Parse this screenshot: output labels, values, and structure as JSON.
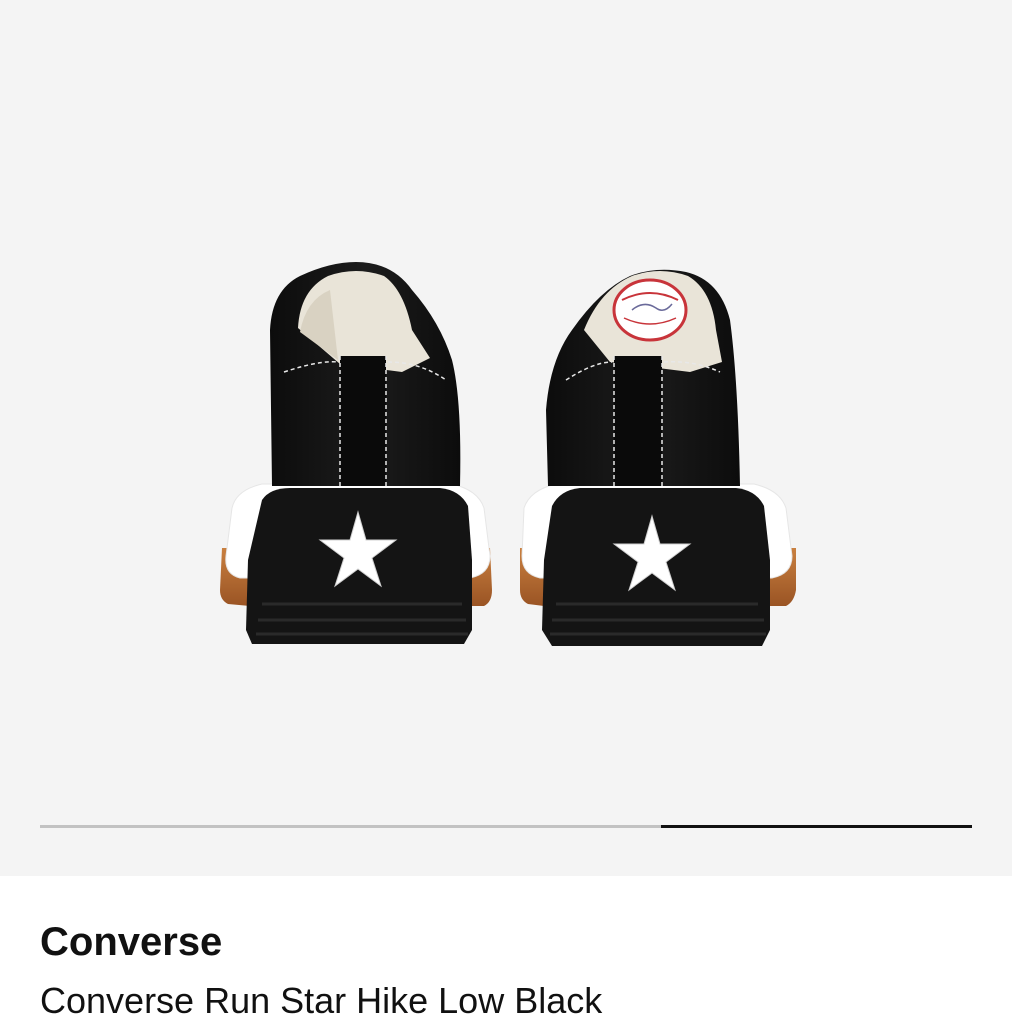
{
  "product": {
    "brand": "Converse",
    "name": "Converse Run Star Hike Low Black"
  },
  "gallery": {
    "image_description": "Black Converse Run Star Hike low sneakers, rear view",
    "background_color": "#f4f4f4",
    "indicator_track_color": "#c2c2c2",
    "indicator_active_color": "#111111",
    "image_count": 3,
    "active_index": 3
  },
  "colors": {
    "shoe_canvas": "#121212",
    "midsole": "#ffffff",
    "outsole": "#141414",
    "gum": "#b86a2e",
    "lining": "#e9e4d8"
  }
}
